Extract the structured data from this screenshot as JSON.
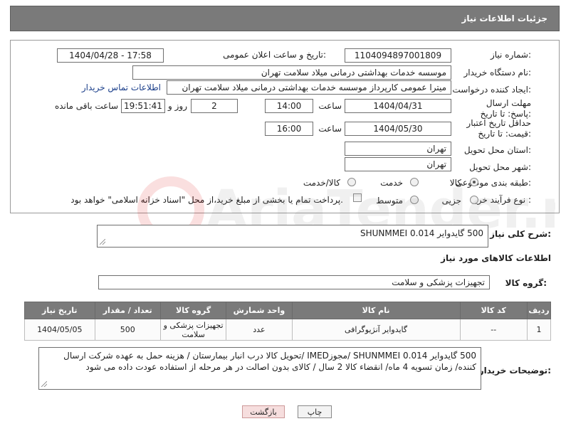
{
  "header": {
    "title": "جزئیات اطلاعات نیاز"
  },
  "form": {
    "need_number": {
      "label": "شماره نیاز:",
      "value": "1104094897001809"
    },
    "announce": {
      "label": "تاریخ و ساعت اعلان عمومی:",
      "value": "1404/04/28 - 17:58"
    },
    "buyer_org": {
      "label": "نام دستگاه خریدار:",
      "value": "موسسه خدمات بهداشتی درمانی میلاد سلامت تهران"
    },
    "requester": {
      "label": "ایجاد کننده درخواست:",
      "value": "میترا عمومی کارپرداز موسسه خدمات بهداشتی درمانی میلاد سلامت تهران",
      "contact_link": "اطلاعات تماس خریدار"
    },
    "deadline": {
      "label": "مهلت ارسال پاسخ: تا تاریخ:",
      "date": "1404/04/31",
      "time_label": "ساعت",
      "time": "14:00",
      "days": "2",
      "days_label": "روز و",
      "remaining": "19:51:41",
      "remaining_label": "ساعت باقی مانده"
    },
    "min_price": {
      "label": "حداقل تاریخ اعتبار قیمت: تا تاریخ:",
      "date": "1404/05/30",
      "time_label": "ساعت",
      "time": "16:00"
    },
    "province": {
      "label": "استان محل تحویل:",
      "value": "تهران"
    },
    "city": {
      "label": "شهر محل تحویل:",
      "value": "تهران"
    },
    "category": {
      "label": "طبقه بندی موضوعی:",
      "options": [
        "کالا",
        "خدمت",
        "کالا/خدمت"
      ],
      "selected": "کالا"
    },
    "process": {
      "label": "نوع فرآیند خرید :",
      "options": [
        "جزیی",
        "متوسط"
      ],
      "payment_note": "پرداخت تمام یا بخشی از مبلغ خرید،از محل \"اسناد خزانه اسلامی\" خواهد بود."
    }
  },
  "description": {
    "label": "شرح کلی نیاز:",
    "value": "500 گایدوایر SHUNMMEI 0.014"
  },
  "goods_info": {
    "title": "اطلاعات کالاهای مورد نیاز"
  },
  "goods_group": {
    "label": "گروه کالا:",
    "value": "تجهیزات پزشکی و سلامت"
  },
  "table": {
    "headers": [
      "ردیف",
      "کد کالا",
      "نام کالا",
      "واحد شمارش",
      "گروه کالا",
      "تعداد / مقدار",
      "تاریخ نیاز"
    ],
    "rows": [
      [
        "1",
        "--",
        "گایدوایر آنژیوگرافی",
        "عدد",
        "تجهیزات پزشکی و سلامت",
        "500",
        "1404/05/05"
      ]
    ]
  },
  "buyer_notes": {
    "label": "توضیحات خریدار:",
    "value": "500 گایدوایر SHUNMMEI 0.014 /مجوزIMED /تحویل کالا درب انبار بیمارستان / هزینه حمل به عهده شرکت ارسال کننده/ زمان تسویه 4 ماه/ انقضاء کالا 2 سال / کالای بدون اصالت در هر مرحله از استفاده عودت داده می شود"
  },
  "buttons": {
    "print": "چاپ",
    "back": "بازگشت"
  },
  "watermark": {
    "text": "AriaTender.net"
  }
}
